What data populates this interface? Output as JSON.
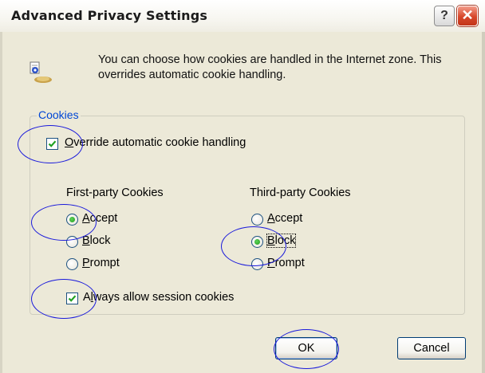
{
  "window": {
    "title": "Advanced Privacy Settings",
    "help_glyph": "?",
    "close_glyph": "✕"
  },
  "intro": {
    "text": "You can choose how cookies are handled in the Internet zone.  This overrides automatic cookie handling.",
    "icon": "privacy-eye-icon"
  },
  "cookies_group": {
    "legend": "Cookies",
    "override": {
      "label_underlined": "O",
      "label_rest": "verride automatic cookie handling",
      "checked": true
    },
    "first_party": {
      "header": "First-party Cookies",
      "options": [
        {
          "ul": "A",
          "rest": "ccept",
          "selected": true
        },
        {
          "ul": "B",
          "rest": "lock",
          "selected": false
        },
        {
          "ul": "P",
          "rest": "rompt",
          "selected": false
        }
      ]
    },
    "third_party": {
      "header": "Third-party Cookies",
      "options": [
        {
          "ul": "A",
          "rest": "ccept",
          "selected": false
        },
        {
          "ul": "B",
          "rest": "lock",
          "selected": true
        },
        {
          "ul": "P",
          "rest": "rompt",
          "selected": false
        }
      ]
    },
    "session": {
      "label_pre": "A",
      "label_ul": "l",
      "label_rest": "ways allow session cookies",
      "checked": true
    }
  },
  "buttons": {
    "ok": "OK",
    "cancel": "Cancel"
  },
  "colors": {
    "accent": "#0046d5",
    "annotation": "#1a1adb",
    "dialog_bg": "#ece9d8"
  }
}
